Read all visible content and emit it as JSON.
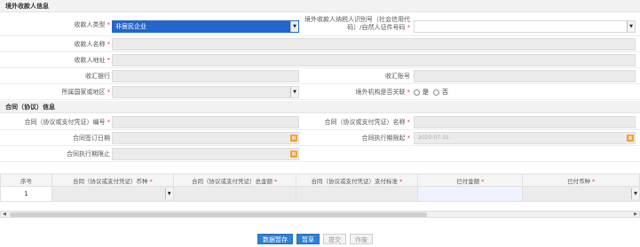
{
  "section1": {
    "title": "境外收款人信息"
  },
  "payee": {
    "type_label": "收款人类型",
    "type_value": "非居民企业",
    "tax_id_label": "境外收款人纳税人识别号（社会信用代码）/自然人证件号码",
    "name_label": "收款人名称",
    "address_label": "收款人地址",
    "bank_label": "收汇银行",
    "account_label": "收汇账号",
    "country_label": "所属国家或地区",
    "related_label": "境外机构是否关联",
    "related_yes": "是",
    "related_no": "否"
  },
  "section2": {
    "title": "合同（协议）信息"
  },
  "contract": {
    "no_label": "合同（协议或支付凭证）编号",
    "name_label": "合同（协议或支付凭证）名称",
    "sign_date_label": "合同签订日期",
    "start_label": "合同执行期限起",
    "start_placeholder": "2020-07-31",
    "end_label": "合同执行期限止"
  },
  "table": {
    "headers": [
      "序号",
      "合同（协议或支付凭证）币种",
      "合同（协议或支付凭证）总金额",
      "合同（协议或支付凭证）支付标准",
      "已付金额",
      "已付币种"
    ],
    "rows": [
      [
        "1"
      ]
    ]
  },
  "buttons": {
    "save": "数据暂存",
    "save_draft": "暂草",
    "submit": "提交",
    "void": "作废"
  },
  "colors": {
    "accent": "#2266cc",
    "required": "#e04040",
    "calendar": "#f0a030"
  }
}
